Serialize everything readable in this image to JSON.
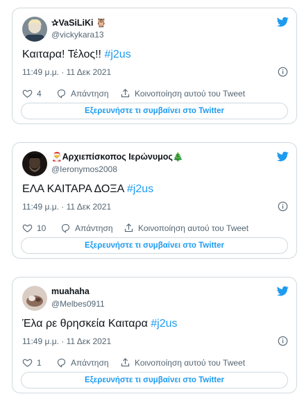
{
  "colors": {
    "accent": "#1d9bf0",
    "text": "#0f1419",
    "muted": "#536471",
    "border": "#cfd9de"
  },
  "tweets": [
    {
      "name": "✰VaSiLiKi 🦉",
      "handle": "@vickykara13",
      "text": "Καιταρα! Τέλος!! ",
      "hashtag": "#j2us",
      "time": "11:49 μ.μ. · 11 Δεκ 2021",
      "likes": "4",
      "reply_label": "Απάντηση",
      "share_label": "Κοινοποίηση αυτού του Tweet",
      "explore_label": "Εξερευνήστε τι συμβαίνει στο Twitter"
    },
    {
      "name": "🎅Αρχιεπίσκοπος Ιερώνυμος🎄",
      "handle": "@Ieronymos2008",
      "text": "ΕΛΑ ΚΑΙΤΑΡΑ ΔΟΞΑ ",
      "hashtag": "#j2us",
      "time": "11:49 μ.μ. · 11 Δεκ 2021",
      "likes": "10",
      "reply_label": "Απάντηση",
      "share_label": "Κοινοποίηση αυτού του Tweet",
      "explore_label": "Εξερευνήστε τι συμβαίνει στο Twitter"
    },
    {
      "name": "muahaha",
      "handle": "@Melbes0911",
      "text": "Έλα ρε θρησκεία Καιταρα ",
      "hashtag": "#j2us",
      "time": "11:49 μ.μ. · 11 Δεκ 2021",
      "likes": "1",
      "reply_label": "Απάντηση",
      "share_label": "Κοινοποίηση αυτού του Tweet",
      "explore_label": "Εξερευνήστε τι συμβαίνει στο Twitter"
    }
  ]
}
